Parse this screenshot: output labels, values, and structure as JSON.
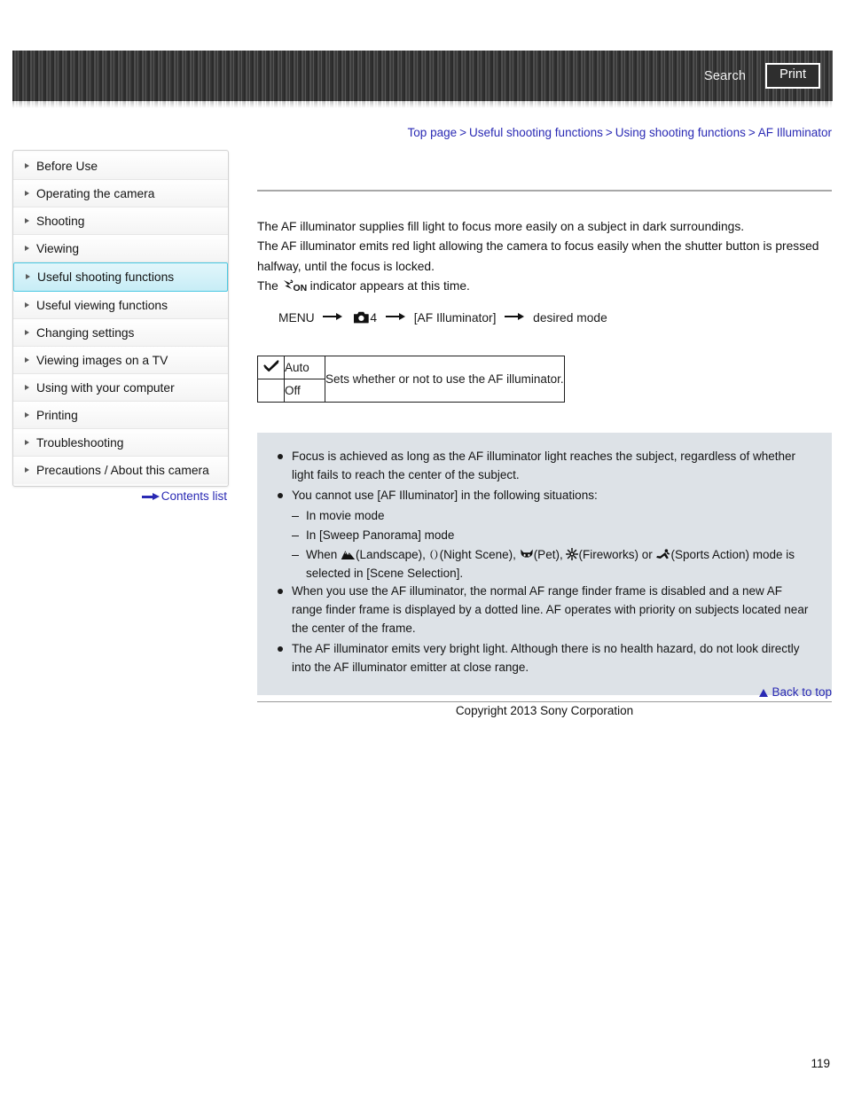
{
  "header": {
    "search_label": "Search",
    "print_label": "Print"
  },
  "breadcrumb": {
    "items": [
      {
        "label": "Top page"
      },
      {
        "label": "Useful shooting functions"
      },
      {
        "label": "Using shooting functions"
      },
      {
        "label": "AF Illuminator"
      }
    ],
    "separator": ">"
  },
  "sidebar": {
    "items": [
      {
        "label": "Before Use",
        "active": false
      },
      {
        "label": "Operating the camera",
        "active": false
      },
      {
        "label": "Shooting",
        "active": false
      },
      {
        "label": "Viewing",
        "active": false
      },
      {
        "label": "Useful shooting functions",
        "active": true
      },
      {
        "label": "Useful viewing functions",
        "active": false
      },
      {
        "label": "Changing settings",
        "active": false
      },
      {
        "label": "Viewing images on a TV",
        "active": false
      },
      {
        "label": "Using with your computer",
        "active": false
      },
      {
        "label": "Printing",
        "active": false
      },
      {
        "label": "Troubleshooting",
        "active": false
      },
      {
        "label": "Precautions / About this camera",
        "active": false
      }
    ],
    "contents_list_label": "Contents list"
  },
  "main": {
    "paragraph_1": "The AF illuminator supplies fill light to focus more easily on a subject in dark surroundings.",
    "paragraph_2": "The AF illuminator emits red light allowing the camera to focus easily when the shutter button is pressed halfway, until the focus is locked.",
    "indicator_prefix": "The",
    "indicator_icon_label": "ON",
    "indicator_suffix": "indicator appears at this time.",
    "menu_path": {
      "menu_label": "MENU",
      "tab_number": "4",
      "setting_label": "[AF Illuminator]",
      "result_label": "desired mode"
    },
    "settings_table": {
      "rows": [
        {
          "checked": true,
          "option": "Auto"
        },
        {
          "checked": false,
          "option": "Off"
        }
      ],
      "description": "Sets whether or not to use the AF illuminator."
    },
    "notes": [
      {
        "text": "Focus is achieved as long as the AF illuminator light reaches the subject, regardless of whether light fails to reach the center of the subject."
      },
      {
        "text": "You cannot use [AF Illuminator] in the following situations:",
        "sub": [
          {
            "text": "In movie mode"
          },
          {
            "text": "In [Sweep Panorama] mode"
          },
          {
            "rich": true,
            "prefix": "When",
            "modes": [
              {
                "icon": "landscape-icon",
                "label": "(Landscape),"
              },
              {
                "icon": "night-scene-icon",
                "label": "(Night Scene),"
              },
              {
                "icon": "pet-icon",
                "label": "(Pet),"
              },
              {
                "icon": "fireworks-icon",
                "label": "(Fireworks) or"
              },
              {
                "icon": "sports-action-icon",
                "label": "(Sports Action) mode is"
              }
            ],
            "suffix": "selected in [Scene Selection]."
          }
        ]
      },
      {
        "text": "When you use the AF illuminator, the normal AF range finder frame is disabled and a new AF range finder frame is displayed by a dotted line. AF operates with priority on subjects located near the center of the frame."
      },
      {
        "text": "The AF illuminator emits very bright light. Although there is no health hazard, do not look directly into the AF illuminator emitter at close range."
      }
    ]
  },
  "footer": {
    "back_to_top_label": "Back to top",
    "copyright": "Copyright 2013 Sony Corporation",
    "page_number": "119"
  },
  "colors": {
    "link": "#2a2ab4",
    "active_nav_border": "#49c8e2",
    "notes_bg": "#dde2e7",
    "banner": "#3b3b3b"
  }
}
